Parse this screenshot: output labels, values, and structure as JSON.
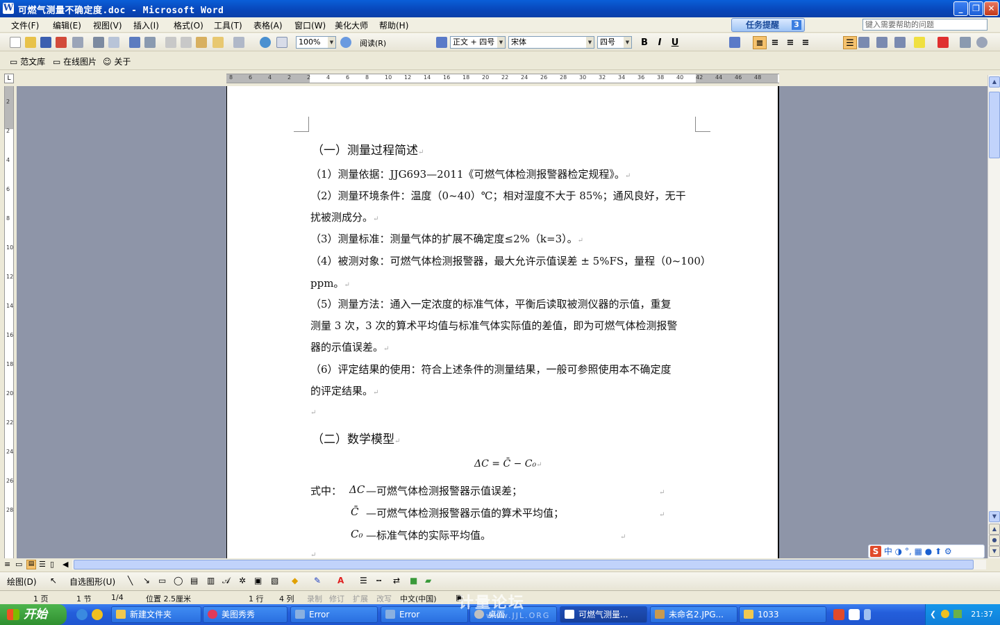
{
  "window": {
    "title": "可燃气测量不确定度.doc - Microsoft Word",
    "app_icon": "W",
    "controls": {
      "minimize": "_",
      "restore": "❐",
      "close": "✕"
    }
  },
  "menu": [
    "文件(F)",
    "编辑(E)",
    "视图(V)",
    "插入(I)",
    "格式(O)",
    "工具(T)",
    "表格(A)",
    "窗口(W)",
    "美化大师",
    "帮助(H)"
  ],
  "task_reminder": {
    "label": "任务提醒",
    "count": "3"
  },
  "help_search": {
    "placeholder": "键入需要帮助的问题"
  },
  "standard_toolbar": {
    "zoom": "100%",
    "read_label": "阅读(R)"
  },
  "formatting_toolbar": {
    "style": "正文 + 四号",
    "font": "宋体",
    "size": "四号",
    "bold": "B",
    "italic": "I",
    "underline": "U"
  },
  "extra_toolbar": {
    "item1": "范文库",
    "item2": "在线图片",
    "item3": "关于"
  },
  "ruler": {
    "horizontal_ticks": [
      "8",
      "6",
      "4",
      "2",
      "2",
      "4",
      "6",
      "8",
      "10",
      "12",
      "14",
      "16",
      "18",
      "20",
      "22",
      "24",
      "26",
      "28",
      "30",
      "32",
      "34",
      "36",
      "38",
      "40",
      "42",
      "44",
      "46",
      "48"
    ],
    "vertical_ticks": [
      "2",
      "2",
      "4",
      "6",
      "8",
      "10",
      "12",
      "14",
      "16",
      "18",
      "20",
      "22",
      "24",
      "26",
      "28"
    ],
    "corner": "L"
  },
  "document": {
    "heading1": "（一）测量过程简述",
    "p1": "（1）测量依据：JJG693—2011《可燃气体检测报警器检定规程》。",
    "p2a": "（2）测量环境条件：温度（0~40）℃；相对湿度不大于 85%；通风良好，无干",
    "p2b": "扰被测成分。",
    "p3": "（3）测量标准：测量气体的扩展不确定度≤2%（k=3）。",
    "p4a": "（4）被测对象：可燃气体检测报警器，最大允许示值误差 ± 5%FS，量程（0~100）",
    "p4b": "ppm。",
    "p5a": "（5）测量方法：通入一定浓度的标准气体，平衡后读取被测仪器的示值，重复",
    "p5b": "测量 3 次，3 次的算术平均值与标准气体实际值的差值，即为可燃气体检测报警",
    "p5c": "器的示值误差。",
    "p6a": "（6）评定结果的使用：符合上述条件的测量结果，一般可参照使用本不确定度",
    "p6b": "的评定结果。",
    "heading2": "（二）数学模型",
    "formula": "ΔC = C̄ − C₀",
    "where_label": "式中：",
    "def1_sym": "ΔC",
    "def1": "—可燃气体检测报警器示值误差；",
    "def2_sym": "C̄",
    "def2": "—可燃气体检测报警器示值的算术平均值；",
    "def3_sym": "C₀",
    "def3": "—标准气体的实际平均值。",
    "para_mark": "↵"
  },
  "drawing_toolbar": {
    "draw": "绘图(D)",
    "autoshapes": "自选图形(U)"
  },
  "status": {
    "page": "1 页",
    "section": "1 节",
    "pages": "1/4",
    "position": "位置 2.5厘米",
    "line": "1 行",
    "column": "4 列",
    "rec": "录制",
    "trk": "修订",
    "ext": "扩展",
    "ovr": "改写",
    "language": "中文(中国)"
  },
  "ime": {
    "logo": "S",
    "mode": "中"
  },
  "taskbar": {
    "start": "开始",
    "tasks": [
      "新建文件夹",
      "美图秀秀",
      "Error",
      "Error",
      "桌面",
      "可燃气测量...",
      "未命名2.JPG...",
      "1033"
    ],
    "clock": "21:37"
  },
  "watermark": {
    "line1": "计量论坛",
    "line2": "www.JJL.ORG"
  },
  "colors": {
    "titlebar": "#0a5fd8",
    "page_bg": "#8e95a8",
    "taskbar": "#245edb",
    "start": "#2f8f2f"
  }
}
